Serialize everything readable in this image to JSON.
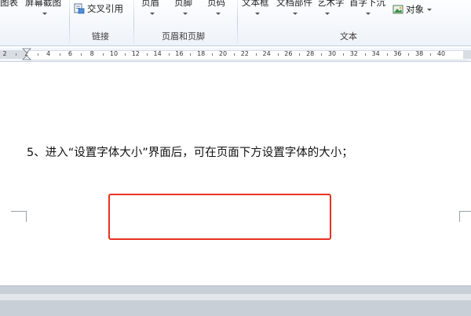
{
  "ribbon": {
    "top_labels": {
      "chart": "图表",
      "screenshot": "屏幕截图",
      "header": "页眉",
      "footer": "页脚",
      "page_number": "页码",
      "text_box": "文本框",
      "quick_parts": "文档部件",
      "wordart": "艺术字",
      "drop_cap": "首字下沉"
    },
    "cross_reference": "交叉引用",
    "object": "对象",
    "groups": {
      "links": "链接",
      "header_footer": "页眉和页脚",
      "text": "文本"
    }
  },
  "ruler": {
    "ticks": [
      "2",
      "2",
      "4",
      "6",
      "8",
      "10",
      "12",
      "14",
      "16",
      "18",
      "20",
      "22",
      "24",
      "26",
      "28",
      "30",
      "32",
      "34",
      "36",
      "38",
      "40"
    ]
  },
  "document": {
    "instruction": "5、进入“设置字体大小”界面后，可在页面下方设置字体的大小；"
  },
  "colors": {
    "highlight": "#e8321f",
    "ribbon_bg": "#eef3f9",
    "bottom_bar": "#c9cfd7"
  },
  "icons": [
    "cross-reference-icon",
    "object-icon",
    "ruler-indent-marker-icon"
  ]
}
